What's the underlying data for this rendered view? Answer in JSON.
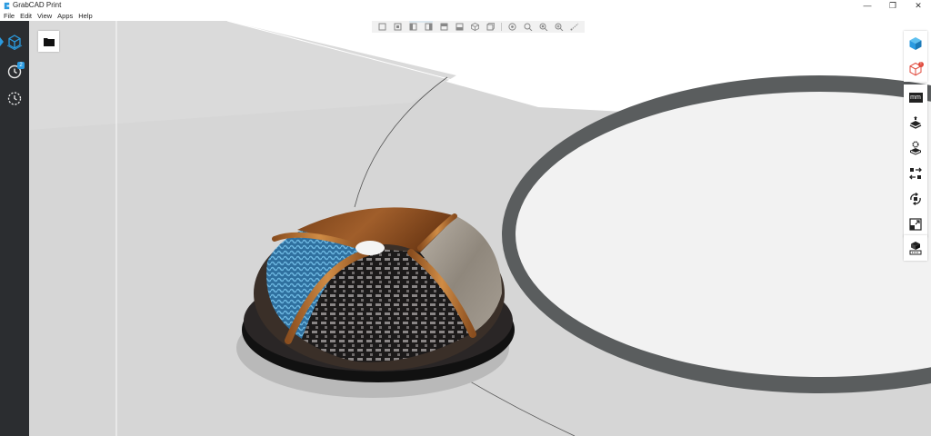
{
  "window": {
    "title": "GrabCAD Print",
    "controls": {
      "minimize": "—",
      "maximize": "❐",
      "close": "✕"
    }
  },
  "menu": [
    "File",
    "Edit",
    "View",
    "Apps",
    "Help"
  ],
  "sidebar": {
    "items": [
      {
        "name": "models",
        "icon": "cube-outline-icon",
        "active": true
      },
      {
        "name": "job-queue",
        "icon": "clock-icon",
        "badge": "2"
      },
      {
        "name": "history",
        "icon": "history-icon"
      }
    ]
  },
  "right_toolbar": {
    "units_label": "mm",
    "warning_badge": "!"
  },
  "colors": {
    "accent": "#2b9be0",
    "sidebar": "#2b2d30",
    "viewport_floor": "#d6d6d6",
    "tray_ring": "#5a5d5e",
    "warning": "#e04a3c"
  }
}
